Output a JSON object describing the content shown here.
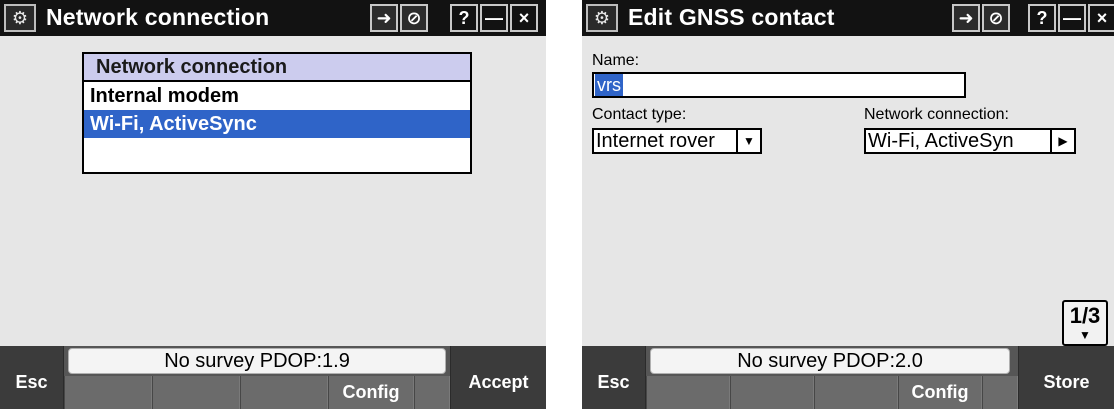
{
  "left": {
    "title": "Network connection",
    "title_buttons": [
      "➜",
      "⊘",
      "?",
      "—",
      "×"
    ],
    "list": {
      "header": "Network connection",
      "items": [
        "Internal modem",
        "Wi-Fi,  ActiveSync"
      ],
      "selected_index": 1
    },
    "footer": {
      "left_label": "Esc",
      "status": "No survey  PDOP:1.9",
      "slots": [
        "",
        "",
        "",
        "Config"
      ],
      "right_label": "Accept"
    }
  },
  "right": {
    "title": "Edit GNSS contact",
    "title_buttons": [
      "➜",
      "⊘",
      "?",
      "—",
      "×"
    ],
    "form": {
      "name_label": "Name:",
      "name_value": "vrs",
      "contact_type_label": "Contact type:",
      "contact_type_value": "Internet rover",
      "network_connection_label": "Network connection:",
      "network_connection_value": "Wi-Fi,  ActiveSyn"
    },
    "page_indicator": "1/3",
    "footer": {
      "left_label": "Esc",
      "status": "No survey  PDOP:2.0",
      "slots": [
        "",
        "",
        "",
        "Config"
      ],
      "right_label": "Store"
    }
  },
  "icons": {
    "app_logo": "trimble-logo-icon",
    "forward": "forward-arrow-icon",
    "disable": "disable-icon",
    "help": "help-icon",
    "minimize": "minimize-icon",
    "close": "close-icon"
  }
}
